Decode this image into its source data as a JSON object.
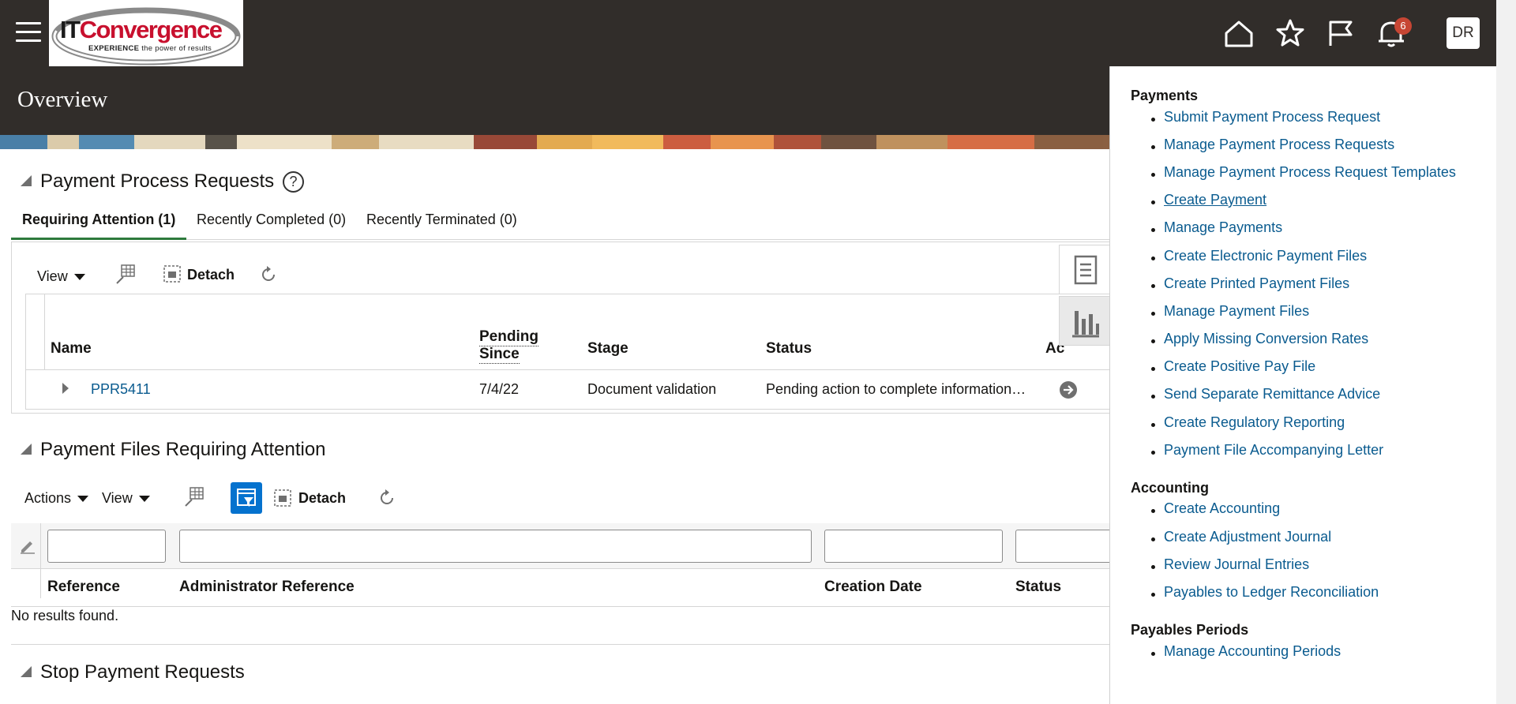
{
  "header": {
    "page_title": "Overview",
    "logo_text_it": "IT",
    "logo_text_rest": "Convergence",
    "logo_tag_bold": "EXPERIENCE",
    "logo_tag_rest": " the power of results",
    "notification_count": "6",
    "avatar_initials": "DR"
  },
  "ppr": {
    "title": "Payment Process Requests",
    "help": "?",
    "tabs": [
      "Requiring Attention (1)",
      "Recently Completed (0)",
      "Recently Terminated (0)"
    ],
    "toolbar": {
      "view": "View",
      "detach": "Detach"
    },
    "columns": {
      "name": "Name",
      "pending_1": "Pending",
      "pending_2": "Since",
      "stage": "Stage",
      "status": "Status",
      "actions": "Ac"
    },
    "rows": [
      {
        "name": "PPR5411",
        "pending_since": "7/4/22",
        "stage": "Document validation",
        "status": "Pending action to complete information…"
      }
    ]
  },
  "pfra": {
    "title": "Payment Files Requiring Attention",
    "toolbar": {
      "actions": "Actions",
      "view": "View",
      "detach": "Detach"
    },
    "columns": {
      "reference": "Reference",
      "admin_reference": "Administrator Reference",
      "creation_date": "Creation Date",
      "status": "Status"
    },
    "empty_text": "No results found."
  },
  "spr": {
    "title": "Stop Payment Requests"
  },
  "tasks_panel": {
    "groups": [
      {
        "title": "Payments",
        "items": [
          "Submit Payment Process Request",
          "Manage Payment Process Requests",
          "Manage Payment Process Request Templates",
          "Create Payment",
          "Manage Payments",
          "Create Electronic Payment Files",
          "Create Printed Payment Files",
          "Manage Payment Files",
          "Apply Missing Conversion Rates",
          "Create Positive Pay File",
          "Send Separate Remittance Advice",
          "Create Regulatory Reporting",
          "Payment File Accompanying Letter"
        ]
      },
      {
        "title": "Accounting",
        "items": [
          "Create Accounting",
          "Create Adjustment Journal",
          "Review Journal Entries",
          "Payables to Ledger Reconciliation"
        ]
      },
      {
        "title": "Payables Periods",
        "items": [
          "Manage Accounting Periods"
        ]
      }
    ]
  },
  "colors": {
    "header_bg": "#312d2a",
    "link": "#0a5b8f",
    "tab_accent": "#2d7a3c",
    "badge": "#c74634",
    "filter_active": "#0572ce"
  }
}
